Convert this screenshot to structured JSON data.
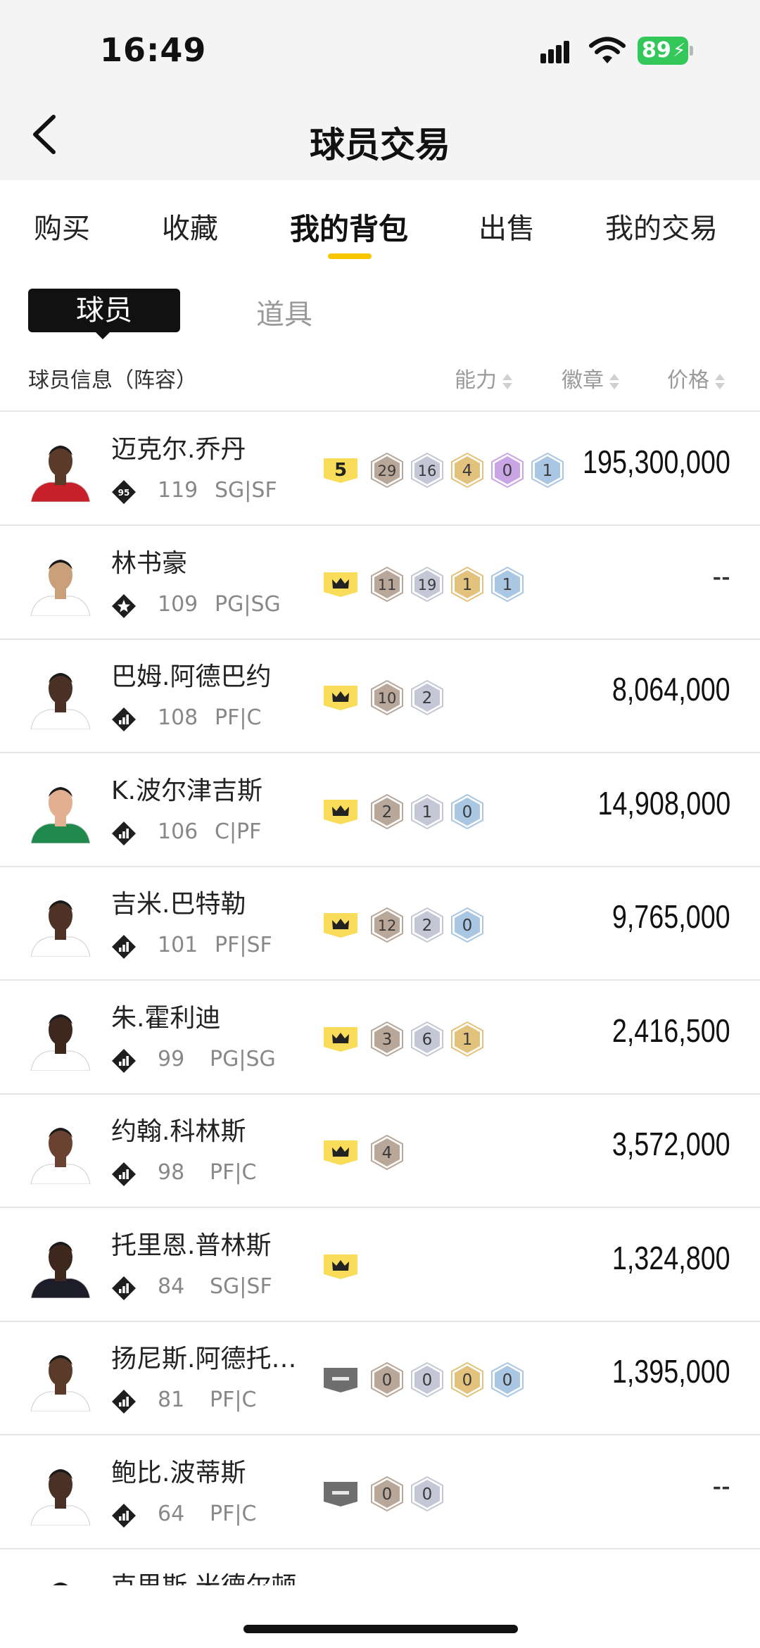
{
  "status_bar": {
    "time": "16:49",
    "battery": "89"
  },
  "header": {
    "title": "球员交易"
  },
  "tabs": [
    {
      "label": "购买",
      "active": false
    },
    {
      "label": "收藏",
      "active": false
    },
    {
      "label": "我的背包",
      "active": true
    },
    {
      "label": "出售",
      "active": false
    },
    {
      "label": "我的交易",
      "active": false
    }
  ],
  "segments": {
    "players": "球员",
    "items": "道具"
  },
  "columns": {
    "info": "球员信息（阵容）",
    "ability": "能力",
    "badges": "徽章",
    "price": "价格"
  },
  "colors": {
    "accent_yellow": "#f7c600",
    "badge_bronze": "#b9a79a",
    "badge_silver": "#c4c8d6",
    "badge_gold": "#e2c27c",
    "badge_purple": "#c9a5e6",
    "badge_blue": "#a9c6e2",
    "crown_badge": "#f8dc5a",
    "gray_badge": "#6e6e6e"
  },
  "players": [
    {
      "name": "迈克尔.乔丹",
      "rating": "119",
      "position": "SG|SF",
      "tier_icon": "tier-95-icon",
      "tier_text": "95",
      "level": {
        "type": "number",
        "text": "5"
      },
      "badges": [
        {
          "tier": "bronze",
          "count": "29"
        },
        {
          "tier": "silver",
          "count": "16"
        },
        {
          "tier": "gold",
          "count": "4"
        },
        {
          "tier": "purple",
          "count": "0"
        },
        {
          "tier": "blue",
          "count": "1"
        }
      ],
      "price": "195,300,000",
      "jersey": "#c8202a",
      "skin": "#5a3a28"
    },
    {
      "name": "林书豪",
      "rating": "109",
      "position": "PG|SG",
      "tier_icon": "star-tier-icon",
      "tier_text": "",
      "level": {
        "type": "crown"
      },
      "badges": [
        {
          "tier": "bronze",
          "count": "11"
        },
        {
          "tier": "silver",
          "count": "19"
        },
        {
          "tier": "gold",
          "count": "1"
        },
        {
          "tier": "blue",
          "count": "1"
        }
      ],
      "price": "--",
      "jersey": "#ffffff",
      "skin": "#c9a07a"
    },
    {
      "name": "巴姆.阿德巴约",
      "rating": "108",
      "position": "PF|C",
      "tier_icon": "bars-tier-icon",
      "tier_text": "",
      "level": {
        "type": "crown"
      },
      "badges": [
        {
          "tier": "bronze",
          "count": "10"
        },
        {
          "tier": "silver",
          "count": "2"
        }
      ],
      "price": "8,064,000",
      "jersey": "#ffffff",
      "skin": "#4a3025"
    },
    {
      "name": "K.波尔津吉斯",
      "rating": "106",
      "position": "C|PF",
      "tier_icon": "bars-tier-icon",
      "tier_text": "",
      "level": {
        "type": "crown"
      },
      "badges": [
        {
          "tier": "bronze",
          "count": "2"
        },
        {
          "tier": "silver",
          "count": "1"
        },
        {
          "tier": "blue",
          "count": "0"
        }
      ],
      "price": "14,908,000",
      "jersey": "#1f8a4c",
      "skin": "#e2b090"
    },
    {
      "name": "吉米.巴特勒",
      "rating": "101",
      "position": "PF|SF",
      "tier_icon": "bars-tier-icon",
      "tier_text": "",
      "level": {
        "type": "crown"
      },
      "badges": [
        {
          "tier": "bronze",
          "count": "12"
        },
        {
          "tier": "silver",
          "count": "2"
        },
        {
          "tier": "blue",
          "count": "0"
        }
      ],
      "price": "9,765,000",
      "jersey": "#ffffff",
      "skin": "#4e3226"
    },
    {
      "name": "朱.霍利迪",
      "rating": "99",
      "position": "PG|SG",
      "tier_icon": "bars-tier-icon",
      "tier_text": "",
      "level": {
        "type": "crown"
      },
      "badges": [
        {
          "tier": "bronze",
          "count": "3"
        },
        {
          "tier": "silver",
          "count": "6"
        },
        {
          "tier": "gold",
          "count": "1"
        }
      ],
      "price": "2,416,500",
      "jersey": "#ffffff",
      "skin": "#3e281e"
    },
    {
      "name": "约翰.科林斯",
      "rating": "98",
      "position": "PF|C",
      "tier_icon": "bars-tier-icon",
      "tier_text": "",
      "level": {
        "type": "crown"
      },
      "badges": [
        {
          "tier": "bronze",
          "count": "4"
        }
      ],
      "price": "3,572,000",
      "jersey": "#ffffff",
      "skin": "#6a4232"
    },
    {
      "name": "托里恩.普林斯",
      "rating": "84",
      "position": "SG|SF",
      "tier_icon": "bars-tier-icon",
      "tier_text": "",
      "level": {
        "type": "crown"
      },
      "badges": [],
      "price": "1,324,800",
      "jersey": "#1d1d2a",
      "skin": "#3e281e"
    },
    {
      "name": "扬尼斯.阿德托…",
      "rating": "81",
      "position": "PF|C",
      "tier_icon": "bars-tier-icon",
      "tier_text": "",
      "level": {
        "type": "gray"
      },
      "badges": [
        {
          "tier": "bronze",
          "count": "0"
        },
        {
          "tier": "silver",
          "count": "0"
        },
        {
          "tier": "gold",
          "count": "0"
        },
        {
          "tier": "blue",
          "count": "0"
        }
      ],
      "price": "1,395,000",
      "jersey": "#ffffff",
      "skin": "#5a3a28"
    },
    {
      "name": "鲍比.波蒂斯",
      "rating": "64",
      "position": "PF|C",
      "tier_icon": "bars-tier-icon",
      "tier_text": "",
      "level": {
        "type": "gray"
      },
      "badges": [
        {
          "tier": "bronze",
          "count": "0"
        },
        {
          "tier": "silver",
          "count": "0"
        }
      ],
      "price": "--",
      "jersey": "#ffffff",
      "skin": "#4a3025"
    },
    {
      "name": "克里斯.米德尔顿",
      "rating": "",
      "position": "",
      "tier_icon": "bars-tier-icon",
      "tier_text": "",
      "level": {
        "type": "gray"
      },
      "badges": [
        {
          "tier": "bronze",
          "count": ""
        }
      ],
      "price": "",
      "jersey": "#ffffff",
      "skin": "#4a3025"
    }
  ]
}
